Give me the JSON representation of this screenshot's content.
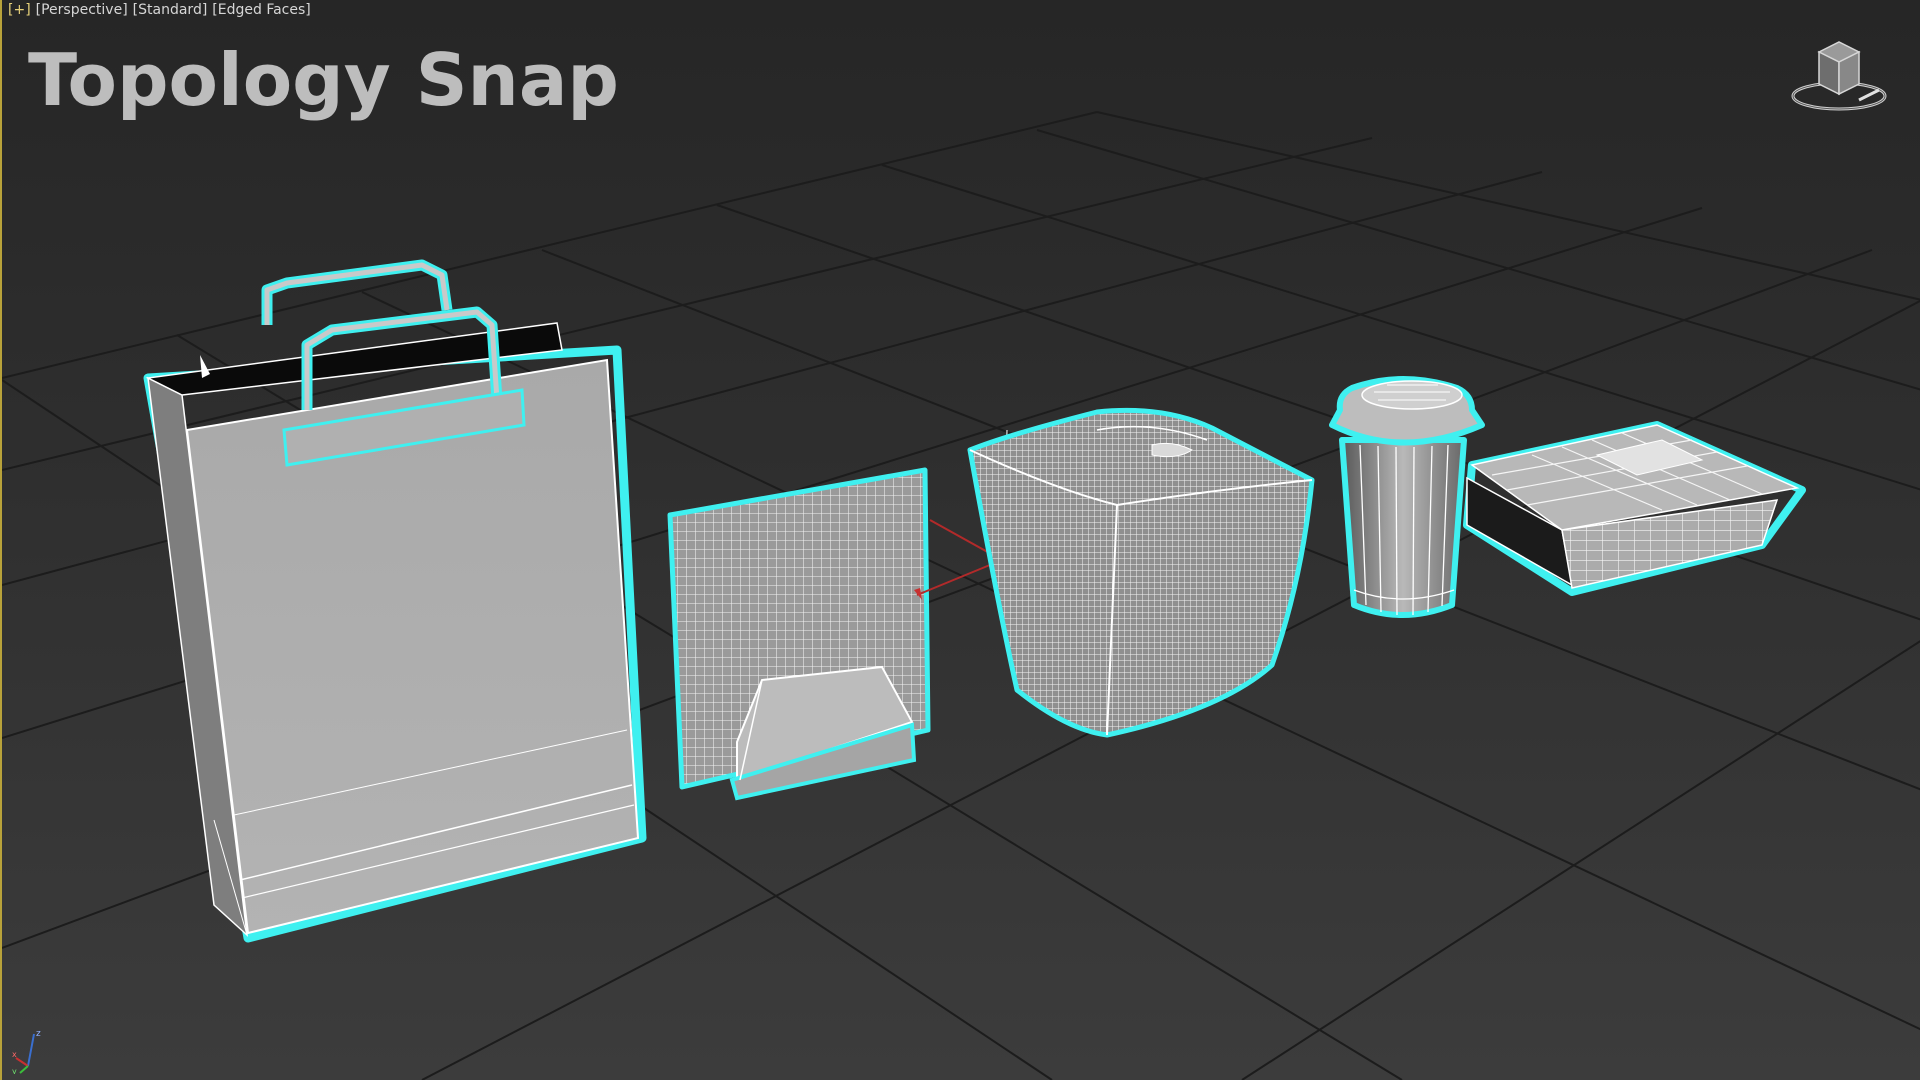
{
  "viewport": {
    "labels": {
      "plus": "[+]",
      "view": "[Perspective]",
      "shading": "[Standard]",
      "display": "[Edged Faces]"
    },
    "title": "Topology Snap"
  },
  "scene_objects": [
    {
      "name": "Paper shopping bag",
      "state": "selected"
    },
    {
      "name": "Napkin holder with napkin",
      "state": "selected"
    },
    {
      "name": "Takeout box",
      "state": "selected"
    },
    {
      "name": "Coffee cup with lid",
      "state": "selected"
    },
    {
      "name": "Food container",
      "state": "selected"
    }
  ],
  "colors": {
    "selection_outline": "#3ff0f0",
    "grid": "#1a1a1a",
    "wireframe": "#ffffff",
    "surface": "#a8a8a8",
    "active_border": "#b8a23a"
  },
  "icons": {
    "viewcube": "viewcube-icon",
    "axis_tripod": "axis-tripod-icon"
  }
}
